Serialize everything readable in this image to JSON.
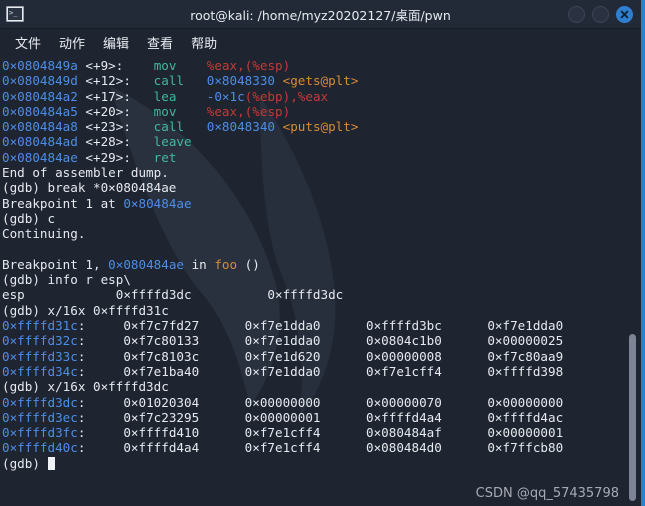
{
  "window": {
    "title": "root@kali: /home/myz20202127/桌面/pwn",
    "app_icon": "terminal-icon",
    "buttons": {
      "minimize": "minimize",
      "maximize": "maximize",
      "close": "close"
    }
  },
  "menubar": {
    "items": [
      {
        "label": "文件"
      },
      {
        "label": "动作"
      },
      {
        "label": "编辑"
      },
      {
        "label": "查看"
      },
      {
        "label": "帮助"
      }
    ]
  },
  "terminal": {
    "prompt": "(gdb) ",
    "cursor_visible": true,
    "colors": {
      "background": "#1e2430",
      "foreground": "#e6e9ef",
      "address_blue": "#4d8ee8",
      "mnemonic_teal": "#3fb8a0",
      "register_red": "#c23b36",
      "symbol_orange": "#d78c35"
    },
    "disassembly": [
      {
        "address": "0×0804849a",
        "offset": "<+9>:",
        "mnemonic": "mov",
        "operands_plain": "",
        "operand_reg1": "%eax",
        "operand_sep": ",",
        "operand_reg2": "(%esp)"
      },
      {
        "address": "0×0804849d",
        "offset": "<+12>:",
        "mnemonic": "call",
        "target": "0×8048330",
        "symbol": "<gets@plt>"
      },
      {
        "address": "0×080484a2",
        "offset": "<+17>:",
        "mnemonic": "lea",
        "disp": "-0×1c",
        "operand_reg1": "(%ebp)",
        "operand_sep": ",",
        "operand_reg2": "%eax"
      },
      {
        "address": "0×080484a5",
        "offset": "<+20>:",
        "mnemonic": "mov",
        "operand_reg1": "%eax",
        "operand_sep": ",",
        "operand_reg2": "(%esp)"
      },
      {
        "address": "0×080484a8",
        "offset": "<+23>:",
        "mnemonic": "call",
        "target": "0×8048340",
        "symbol": "<puts@plt>"
      },
      {
        "address": "0×080484ad",
        "offset": "<+28>:",
        "mnemonic": "leave"
      },
      {
        "address": "0×080484ae",
        "offset": "<+29>:",
        "mnemonic": "ret"
      }
    ],
    "messages": {
      "end_of_dump": "End of assembler dump.",
      "break_cmd": "(gdb) break *0×080484ae",
      "breakpoint_set_prefix": "Breakpoint 1 at ",
      "breakpoint_set_addr": "0×80484ae",
      "continue_cmd": "(gdb) c",
      "continuing": "Continuing.",
      "bp_hit_prefix": "Breakpoint 1, ",
      "bp_hit_addr": "0×080484ae",
      "bp_hit_in": " in ",
      "bp_hit_func": "foo",
      "bp_hit_suffix": " ()",
      "info_r_cmd": "(gdb) info r esp\\",
      "esp_name": "esp",
      "esp_value_hex": "0×ffffd3dc",
      "esp_value_dec": "0×ffffd3dc",
      "x16x_cmd_1": "(gdb) x/16x 0×ffffd31c",
      "x16x_cmd_2": "(gdb) x/16x 0×ffffd3dc",
      "final_prompt": "(gdb) "
    },
    "memory_dump_1": {
      "command": "x/16x 0×ffffd31c",
      "rows": [
        {
          "addr": "0×ffffd31c",
          "words": [
            "0×f7c7fd27",
            "0×f7e1dda0",
            "0×ffffd3bc",
            "0×f7e1dda0"
          ]
        },
        {
          "addr": "0×ffffd32c",
          "words": [
            "0×f7c80133",
            "0×f7e1dda0",
            "0×0804c1b0",
            "0×00000025"
          ]
        },
        {
          "addr": "0×ffffd33c",
          "words": [
            "0×f7c8103c",
            "0×f7e1d620",
            "0×00000008",
            "0×f7c80aa9"
          ]
        },
        {
          "addr": "0×ffffd34c",
          "words": [
            "0×f7e1ba40",
            "0×f7e1dda0",
            "0×f7e1cff4",
            "0×ffffd398"
          ]
        }
      ]
    },
    "memory_dump_2": {
      "command": "x/16x 0×ffffd3dc",
      "rows": [
        {
          "addr": "0×ffffd3dc",
          "words": [
            "0×01020304",
            "0×00000000",
            "0×00000070",
            "0×00000000"
          ]
        },
        {
          "addr": "0×ffffd3ec",
          "words": [
            "0×f7c23295",
            "0×00000001",
            "0×ffffd4a4",
            "0×ffffd4ac"
          ]
        },
        {
          "addr": "0×ffffd3fc",
          "words": [
            "0×ffffd410",
            "0×f7e1cff4",
            "0×080484af",
            "0×00000001"
          ]
        },
        {
          "addr": "0×ffffd40c",
          "words": [
            "0×ffffd4a4",
            "0×f7e1cff4",
            "0×080484d0",
            "0×f7ffcb80"
          ]
        }
      ]
    }
  },
  "scrollbar": {
    "name": "terminal-scrollbar"
  },
  "watermark": {
    "text": "CSDN @qq_57435798"
  }
}
